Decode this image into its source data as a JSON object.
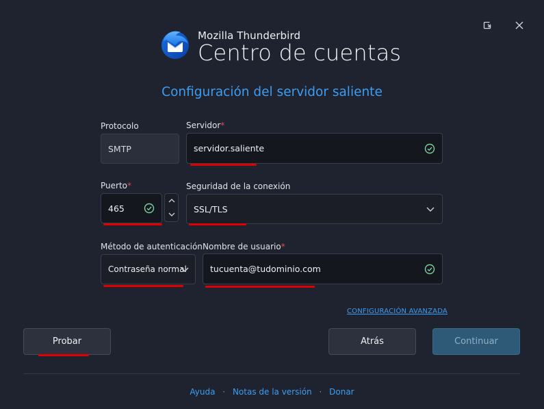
{
  "header": {
    "app_name": "Mozilla Thunderbird",
    "title": "Centro de cuentas"
  },
  "section_title": "Configuración del servidor saliente",
  "fields": {
    "protocol": {
      "label": "Protocolo",
      "value": "SMTP"
    },
    "server": {
      "label": "Servidor",
      "required_mark": "*",
      "value": "servidor.saliente"
    },
    "port": {
      "label": "Puerto",
      "required_mark": "*",
      "value": "465"
    },
    "security": {
      "label": "Seguridad de la conexión",
      "value": "SSL/TLS"
    },
    "auth": {
      "label": "Método de autenticación",
      "value": "Contraseña normal"
    },
    "username": {
      "label": "Nombre de usuario",
      "required_mark": "*",
      "value": "tucuenta@tudominio.com"
    }
  },
  "advanced_link": "CONFIGURACIÓN AVANZADA",
  "buttons": {
    "test": "Probar",
    "back": "Atrás",
    "continue": "Continuar"
  },
  "footer": {
    "help": "Ayuda",
    "release_notes": "Notas de la versión",
    "donate": "Donar",
    "separator": "·"
  },
  "colors": {
    "background": "#1f2330",
    "accent": "#3d9df0",
    "required": "#e5484d",
    "valid": "#7fd0a0",
    "annotation": "#e00000"
  }
}
